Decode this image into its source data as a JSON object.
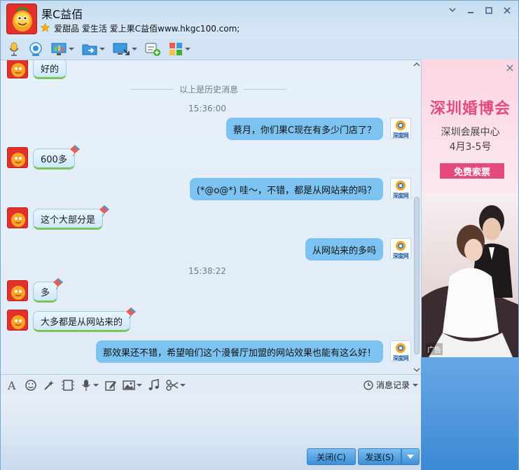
{
  "window": {
    "contact_name": "果C益佰",
    "signature": "爱甜品 爱生活 爱上果C益佰www.hkgc100.com;",
    "controls": [
      "minimize-icon",
      "maximize-icon",
      "close-icon"
    ]
  },
  "toolbar": {
    "items": [
      "microphone-icon",
      "video-icon",
      "remote-desktop-icon",
      "file-transfer-icon",
      "share-screen-icon",
      "add-chat-icon",
      "apps-icon"
    ]
  },
  "chat": {
    "history_divider": "以上是历史消息",
    "messages": [
      {
        "side": "left",
        "text": "好的"
      },
      {
        "side": "time",
        "text": "15:36:00"
      },
      {
        "side": "right",
        "text": "蔡月，你们果C现在有多少门店了？"
      },
      {
        "side": "left",
        "text": "600多"
      },
      {
        "side": "right",
        "text": "(*@o@*) 哇～，不错，都是从网站来的吗？"
      },
      {
        "side": "left",
        "text": "这个大部分是"
      },
      {
        "side": "right",
        "text": "从网站来的多吗"
      },
      {
        "side": "time",
        "text": "15:38:22"
      },
      {
        "side": "left",
        "text": "多"
      },
      {
        "side": "left",
        "text": "大多都是从网站来的"
      },
      {
        "side": "right",
        "text": "那效果还不错，希望咱们这个漫餐厅加盟的网站效果也能有这么好！"
      }
    ],
    "site_avatar_label": "深度网"
  },
  "input_toolbar": {
    "history_label": "消息记录"
  },
  "buttons": {
    "close_label": "关闭(C)",
    "send_label": "发送(S)"
  },
  "ad": {
    "title": "深圳婚博会",
    "venue": "深圳会展中心",
    "date": "4月3-5号",
    "cta": "免费索票",
    "badge": "广告"
  },
  "colors": {
    "accent": "#3d8fd6",
    "bubble_right": "#7dc3f2",
    "bubble_left_border": "#7cc35a",
    "ad_pink": "#e6497c"
  }
}
